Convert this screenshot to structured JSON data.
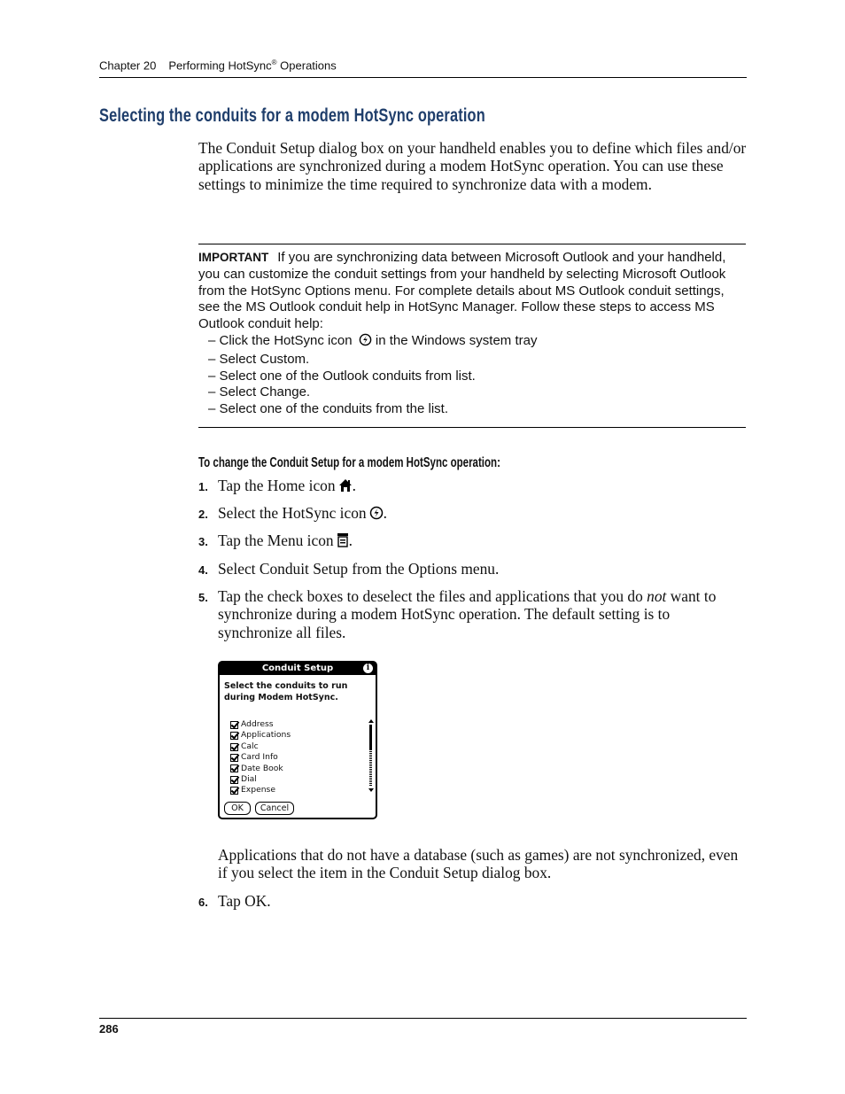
{
  "header": {
    "chapter": "Chapter 20",
    "chapter_title": "Performing HotSync",
    "registered_mark": "®",
    "chapter_title_suffix": " Operations"
  },
  "section": {
    "title": "Selecting the conduits for a modem HotSync operation",
    "intro": "The Conduit Setup dialog box on your handheld enables you to define which files and/or applications are synchronized during a modem HotSync operation. You can use these settings to minimize the time required to synchronize data with a modem."
  },
  "important": {
    "label": "IMPORTANT",
    "text": "If you are synchronizing data between Microsoft Outlook and your handheld, you can customize the conduit settings from your handheld by selecting Microsoft Outlook from the HotSync Options menu. For complete details about MS Outlook conduit settings, see the MS Outlook conduit help in HotSync Manager. Follow these steps to access MS Outlook conduit help:",
    "steps": [
      {
        "before": "– Click the HotSync icon",
        "icon": "hotsync-icon",
        "after": "in the Windows system tray"
      },
      {
        "before": "– Select Custom."
      },
      {
        "before": "– Select one of the Outlook conduits from list."
      },
      {
        "before": "– Select Change."
      },
      {
        "before": "– Select one of the conduits from the list."
      }
    ]
  },
  "procedure": {
    "heading": "To change the Conduit Setup for a modem HotSync operation:",
    "steps": [
      {
        "num": "1.",
        "text": "Tap the Home icon",
        "icon": "home-icon",
        "end": "."
      },
      {
        "num": "2.",
        "text": "Select the HotSync icon",
        "icon": "hotsync-icon",
        "end": "."
      },
      {
        "num": "3.",
        "text": "Tap the Menu icon",
        "icon": "menu-icon",
        "end": "."
      },
      {
        "num": "4.",
        "text": "Select Conduit Setup from the Options menu."
      },
      {
        "num": "5.",
        "text_before": "Tap the check boxes to deselect the files and applications that you do ",
        "emphasis": "not",
        "text_after": " want to synchronize during a modem HotSync operation. The default setting is to synchronize all files."
      },
      {
        "num": "6.",
        "text": "Tap OK."
      }
    ],
    "note": "Applications that do not have a database (such as games) are not synchronized, even if you select the item in the Conduit Setup dialog box."
  },
  "dialog": {
    "title": "Conduit Setup",
    "info_icon": "i",
    "prompt_line1": "Select the conduits to run",
    "prompt_line2": "during Modem HotSync.",
    "items": [
      {
        "label": "Address",
        "checked": true
      },
      {
        "label": "Applications",
        "checked": true
      },
      {
        "label": "Calc",
        "checked": true
      },
      {
        "label": "Card Info",
        "checked": true
      },
      {
        "label": "Date Book",
        "checked": true
      },
      {
        "label": "Dial",
        "checked": true
      },
      {
        "label": "Expense",
        "checked": true
      }
    ],
    "ok_label": "OK",
    "cancel_label": "Cancel"
  },
  "footer": {
    "page_number": "286"
  }
}
